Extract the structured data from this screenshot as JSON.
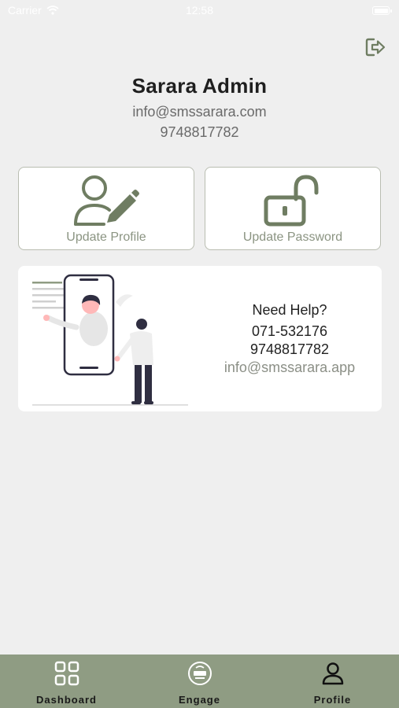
{
  "status_bar": {
    "carrier": "Carrier",
    "time": "12:58"
  },
  "profile": {
    "name": "Sarara Admin",
    "email": "info@smssarara.com",
    "phone": "9748817782"
  },
  "actions": {
    "update_profile": "Update Profile",
    "update_password": "Update Password"
  },
  "help": {
    "title": "Need Help?",
    "phone_1": "071-532176",
    "phone_2": "9748817782",
    "email": "info@smssarara.app"
  },
  "tabs": [
    {
      "label": "Dashboard",
      "icon": "grid-icon"
    },
    {
      "label": "Engage",
      "icon": "engage-logo-icon"
    },
    {
      "label": "Profile",
      "icon": "person-icon"
    }
  ],
  "colors": {
    "accent": "#8f9c83",
    "icon_green": "#6f7d62",
    "background": "#efefef",
    "card_border": "#b9bdb1"
  }
}
